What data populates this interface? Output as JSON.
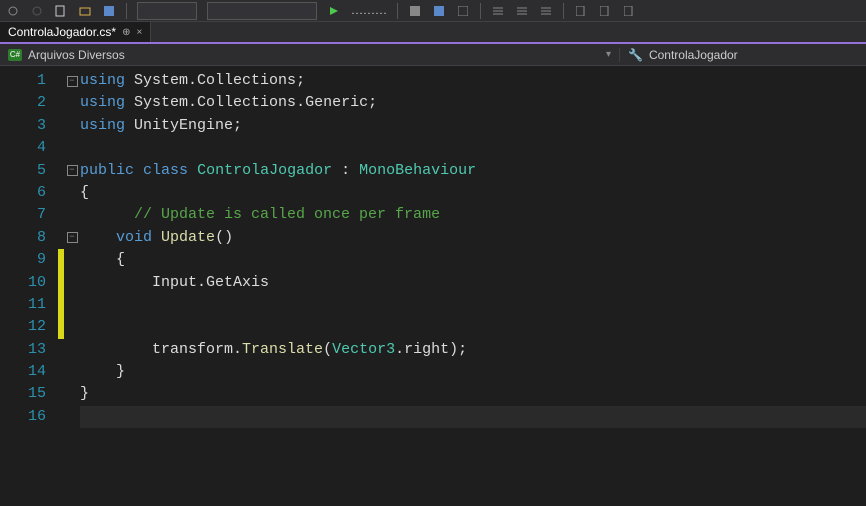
{
  "tab": {
    "filename": "ControlaJogador.cs*",
    "pin_icon": "⊕",
    "close_icon": "×"
  },
  "nav": {
    "left_icon": "C#",
    "left_label": "Arquivos Diversos",
    "right_icon": "⚡",
    "right_label": "ControlaJogador"
  },
  "lines": [
    {
      "n": "1",
      "mod": false,
      "fold": "−",
      "html": "<span class='kw'>using</span> System<span class='punct'>.</span>Collections<span class='punct'>;</span>"
    },
    {
      "n": "2",
      "mod": false,
      "fold": "",
      "html": "<span class='kw'>using</span> System<span class='punct'>.</span>Collections<span class='punct'>.</span>Generic<span class='punct'>;</span>"
    },
    {
      "n": "3",
      "mod": false,
      "fold": "",
      "html": "<span class='kw'>using</span> UnityEngine<span class='punct'>;</span>"
    },
    {
      "n": "4",
      "mod": false,
      "fold": "",
      "html": ""
    },
    {
      "n": "5",
      "mod": false,
      "fold": "−",
      "html": "<span class='kw'>public</span> <span class='kw'>class</span> <span class='type'>ControlaJogador</span> <span class='punct'>:</span> <span class='type'>MonoBehaviour</span>"
    },
    {
      "n": "6",
      "mod": false,
      "fold": "",
      "html": "<span class='punct'>{</span>"
    },
    {
      "n": "7",
      "mod": false,
      "fold": "",
      "html": "      <span class='comment'>// Update is called once per frame</span>"
    },
    {
      "n": "8",
      "mod": false,
      "fold": "−",
      "html": "    <span class='kw'>void</span> <span class='method'>Update</span><span class='punct'>()</span>"
    },
    {
      "n": "9",
      "mod": true,
      "fold": "",
      "html": "    <span class='punct'>{</span>"
    },
    {
      "n": "10",
      "mod": true,
      "fold": "",
      "html": "        Input<span class='punct'>.</span>GetAxis"
    },
    {
      "n": "11",
      "mod": true,
      "fold": "",
      "html": ""
    },
    {
      "n": "12",
      "mod": true,
      "fold": "",
      "html": ""
    },
    {
      "n": "13",
      "mod": false,
      "fold": "",
      "html": "        transform<span class='punct'>.</span><span class='method'>Translate</span><span class='punct'>(</span><span class='type'>Vector3</span><span class='punct'>.</span>right<span class='punct'>);</span>"
    },
    {
      "n": "14",
      "mod": false,
      "fold": "",
      "html": "    <span class='punct'>}</span>"
    },
    {
      "n": "15",
      "mod": false,
      "fold": "",
      "html": "<span class='punct'>}</span>"
    },
    {
      "n": "16",
      "mod": false,
      "fold": "",
      "html": "",
      "last": true
    }
  ]
}
